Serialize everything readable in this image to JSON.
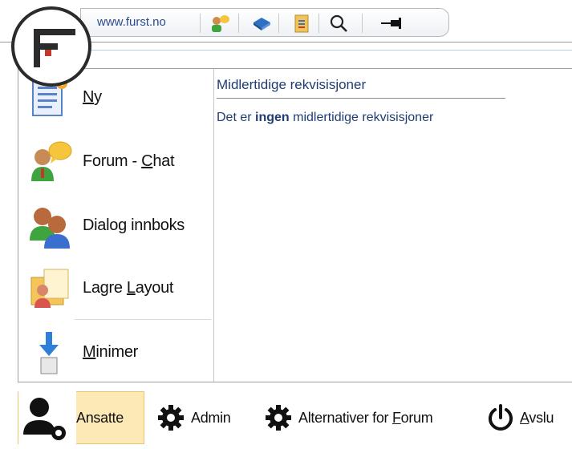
{
  "toolbar": {
    "url": "www.furst.no",
    "icons": [
      "chat-users-icon",
      "book-icon",
      "document-icon",
      "search-icon",
      "pin-icon"
    ]
  },
  "content": {
    "title": "Midlertidige rekvisisjoner",
    "message_pre": "Det er ",
    "message_bold": "ingen",
    "message_post": " midlertidige rekvisisjoner"
  },
  "sidebar": {
    "items": [
      {
        "label_pre": "",
        "label_ul": "N",
        "label_post": "y"
      },
      {
        "label_pre": "Forum - ",
        "label_ul": "C",
        "label_post": "hat"
      },
      {
        "label_pre": "Dialog innboks",
        "label_ul": "",
        "label_post": ""
      },
      {
        "label_pre": "Lagre ",
        "label_ul": "L",
        "label_post": "ayout"
      },
      {
        "label_pre": "",
        "label_ul": "M",
        "label_post": "inimer"
      }
    ]
  },
  "bottombar": {
    "ansatte": "Ansatte",
    "admin": "Admin",
    "alt_pre": "Alternativer for ",
    "alt_ul": "F",
    "alt_post": "orum",
    "avslutt_ul": "A",
    "avslutt_post": "vslu"
  },
  "colors": {
    "accent_text": "#1f3d73",
    "active_bg": "#fce9b6"
  }
}
